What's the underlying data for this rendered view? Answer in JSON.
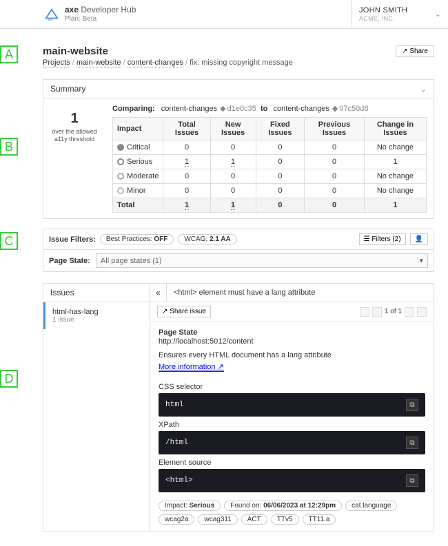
{
  "brand": {
    "title_prefix": "axe",
    "title_rest": "Developer Hub",
    "plan_label": "Plan: Beta"
  },
  "user": {
    "name": "JOHN SMITH",
    "org": "ACME, INC."
  },
  "page": {
    "title": "main-website",
    "breadcrumb": {
      "projects": "Projects",
      "site": "main-website",
      "branch": "content-changes",
      "leaf": "fix: missing copyright message"
    },
    "share": "↗ Share"
  },
  "markers": {
    "a": "A",
    "b": "B",
    "c": "C",
    "d": "D"
  },
  "summary": {
    "heading": "Summary",
    "over_count": "1",
    "over_caption": "over the allowed a11y threshold",
    "comparing_label": "Comparing:",
    "branch_from": "content-changes",
    "commit_from": "d1e0c35",
    "to_word": "to",
    "branch_to": "content-changes",
    "commit_to": "07c50d8",
    "headers": {
      "impact": "Impact",
      "total": "Total Issues",
      "new": "New Issues",
      "fixed": "Fixed Issues",
      "previous": "Previous Issues",
      "change": "Change in Issues"
    },
    "rows": [
      {
        "label": "Critical",
        "sev": "critical",
        "total": "0",
        "new": "0",
        "fixed": "0",
        "prev": "0",
        "change": "No change"
      },
      {
        "label": "Serious",
        "sev": "serious",
        "total": "1",
        "new": "1",
        "fixed": "0",
        "prev": "0",
        "change": "1",
        "link_total": true,
        "link_new": true
      },
      {
        "label": "Moderate",
        "sev": "moderate",
        "total": "0",
        "new": "0",
        "fixed": "0",
        "prev": "0",
        "change": "No change"
      },
      {
        "label": "Minor",
        "sev": "minor",
        "total": "0",
        "new": "0",
        "fixed": "0",
        "prev": "0",
        "change": "No change"
      }
    ],
    "total_row": {
      "label": "Total",
      "total": "1",
      "new": "1",
      "fixed": "0",
      "prev": "0",
      "change": "1"
    }
  },
  "filters": {
    "label": "Issue Filters:",
    "bp": "Best Practices: ",
    "bp_val": "OFF",
    "wcag": "WCAG: ",
    "wcag_val": "2.1 AA",
    "filters_btn": "Filters (2)",
    "person_icon": "person",
    "pagestate_label": "Page State:",
    "pagestate_value": "All page states (1)"
  },
  "issues": {
    "heading": "Issues",
    "side_item": {
      "title": "html-has-lang",
      "count": "1 issue"
    },
    "collapse": "«",
    "title": "<html> element must have a lang attribute",
    "share_issue": "↗ Share issue",
    "pager": "1 of 1",
    "page_state_label": "Page State",
    "page_state_url": "http://localhost:5012/content",
    "ensures": "Ensures every HTML document has a lang attribute",
    "more_info": "More information ↗",
    "css_label": "CSS selector",
    "css_code": "html",
    "xpath_label": "XPath",
    "xpath_code": "/html",
    "src_label": "Element source",
    "src_code": "<html>",
    "tags": {
      "impact": "Impact: ",
      "impact_val": "Serious",
      "found": "Found on: ",
      "found_val": "06/06/2023 at 12:29pm",
      "t1": "cat.language",
      "t2": "wcag2a",
      "t3": "wcag311",
      "t4": "ACT",
      "t5": "TTv5",
      "t6": "TT11.a"
    }
  }
}
